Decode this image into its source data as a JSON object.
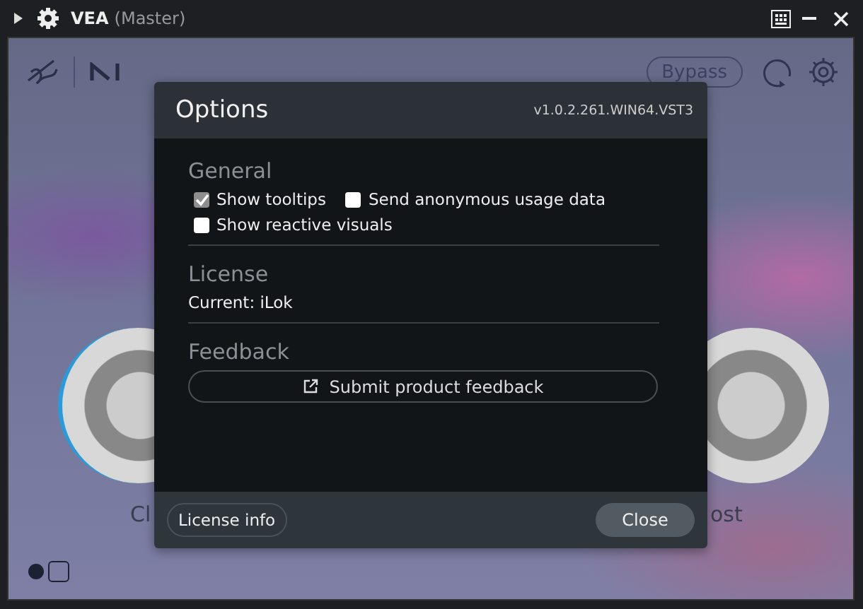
{
  "window": {
    "title": "VEA",
    "subtitle": "(Master)"
  },
  "plugin": {
    "bypass_button": "Bypass",
    "knob_labels": [
      "Cl",
      "ost"
    ]
  },
  "dialog": {
    "title": "Options",
    "version": "v1.0.2.261.WIN64.VST3",
    "sections": [
      {
        "kind": "checkboxes",
        "heading": "General",
        "options": [
          {
            "label": "Show tooltips",
            "checked": true
          },
          {
            "label": "Send anonymous usage data",
            "checked": false
          },
          {
            "label": "Show reactive visuals",
            "checked": false
          }
        ]
      },
      {
        "kind": "text",
        "heading": "License",
        "text": "Current: iLok"
      },
      {
        "kind": "link",
        "heading": "Feedback",
        "button": "Submit product feedback"
      }
    ],
    "footer": {
      "left_button": "License info",
      "right_button": "Close"
    }
  }
}
